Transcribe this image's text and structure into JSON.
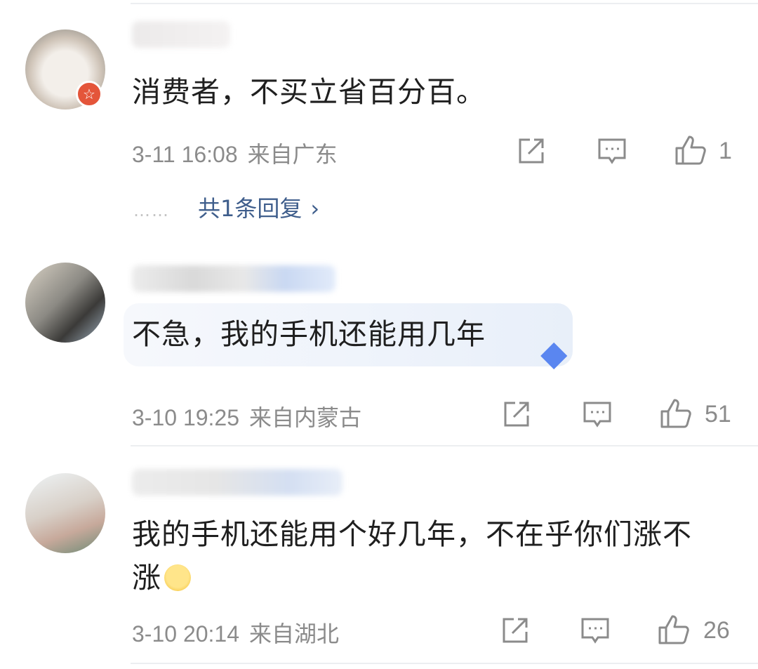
{
  "comments": [
    {
      "avatar": "cat-avatar",
      "badge": "☆",
      "text": "消费者，不买立省百分百。",
      "date": "3-11 16:08",
      "place": "来自广东",
      "likes": "1",
      "replies": "共1条回复",
      "replies_dots": "……",
      "replies_chevron": "›"
    },
    {
      "avatar": "room-avatar",
      "text": "不急，我的手机还能用几年",
      "date": "3-10 19:25",
      "place": "来自内蒙古",
      "likes": "51"
    },
    {
      "avatar": "person-avatar",
      "text_line1": "我的手机还能用个好几年，不在乎你们涨不",
      "text_line2": "涨",
      "date": "3-10 20:14",
      "place": "来自湖北",
      "likes": "26"
    }
  ],
  "icons": {
    "share": "share-icon",
    "comment": "comment-icon",
    "like": "thumbs-up-icon",
    "gem": "diamond-icon",
    "emoji": "smile-emoji-icon"
  },
  "colors": {
    "meta_text": "#8b8b8b",
    "reply_link": "#3f5e8c",
    "badge": "#e4553a",
    "divider": "#eceef1"
  }
}
